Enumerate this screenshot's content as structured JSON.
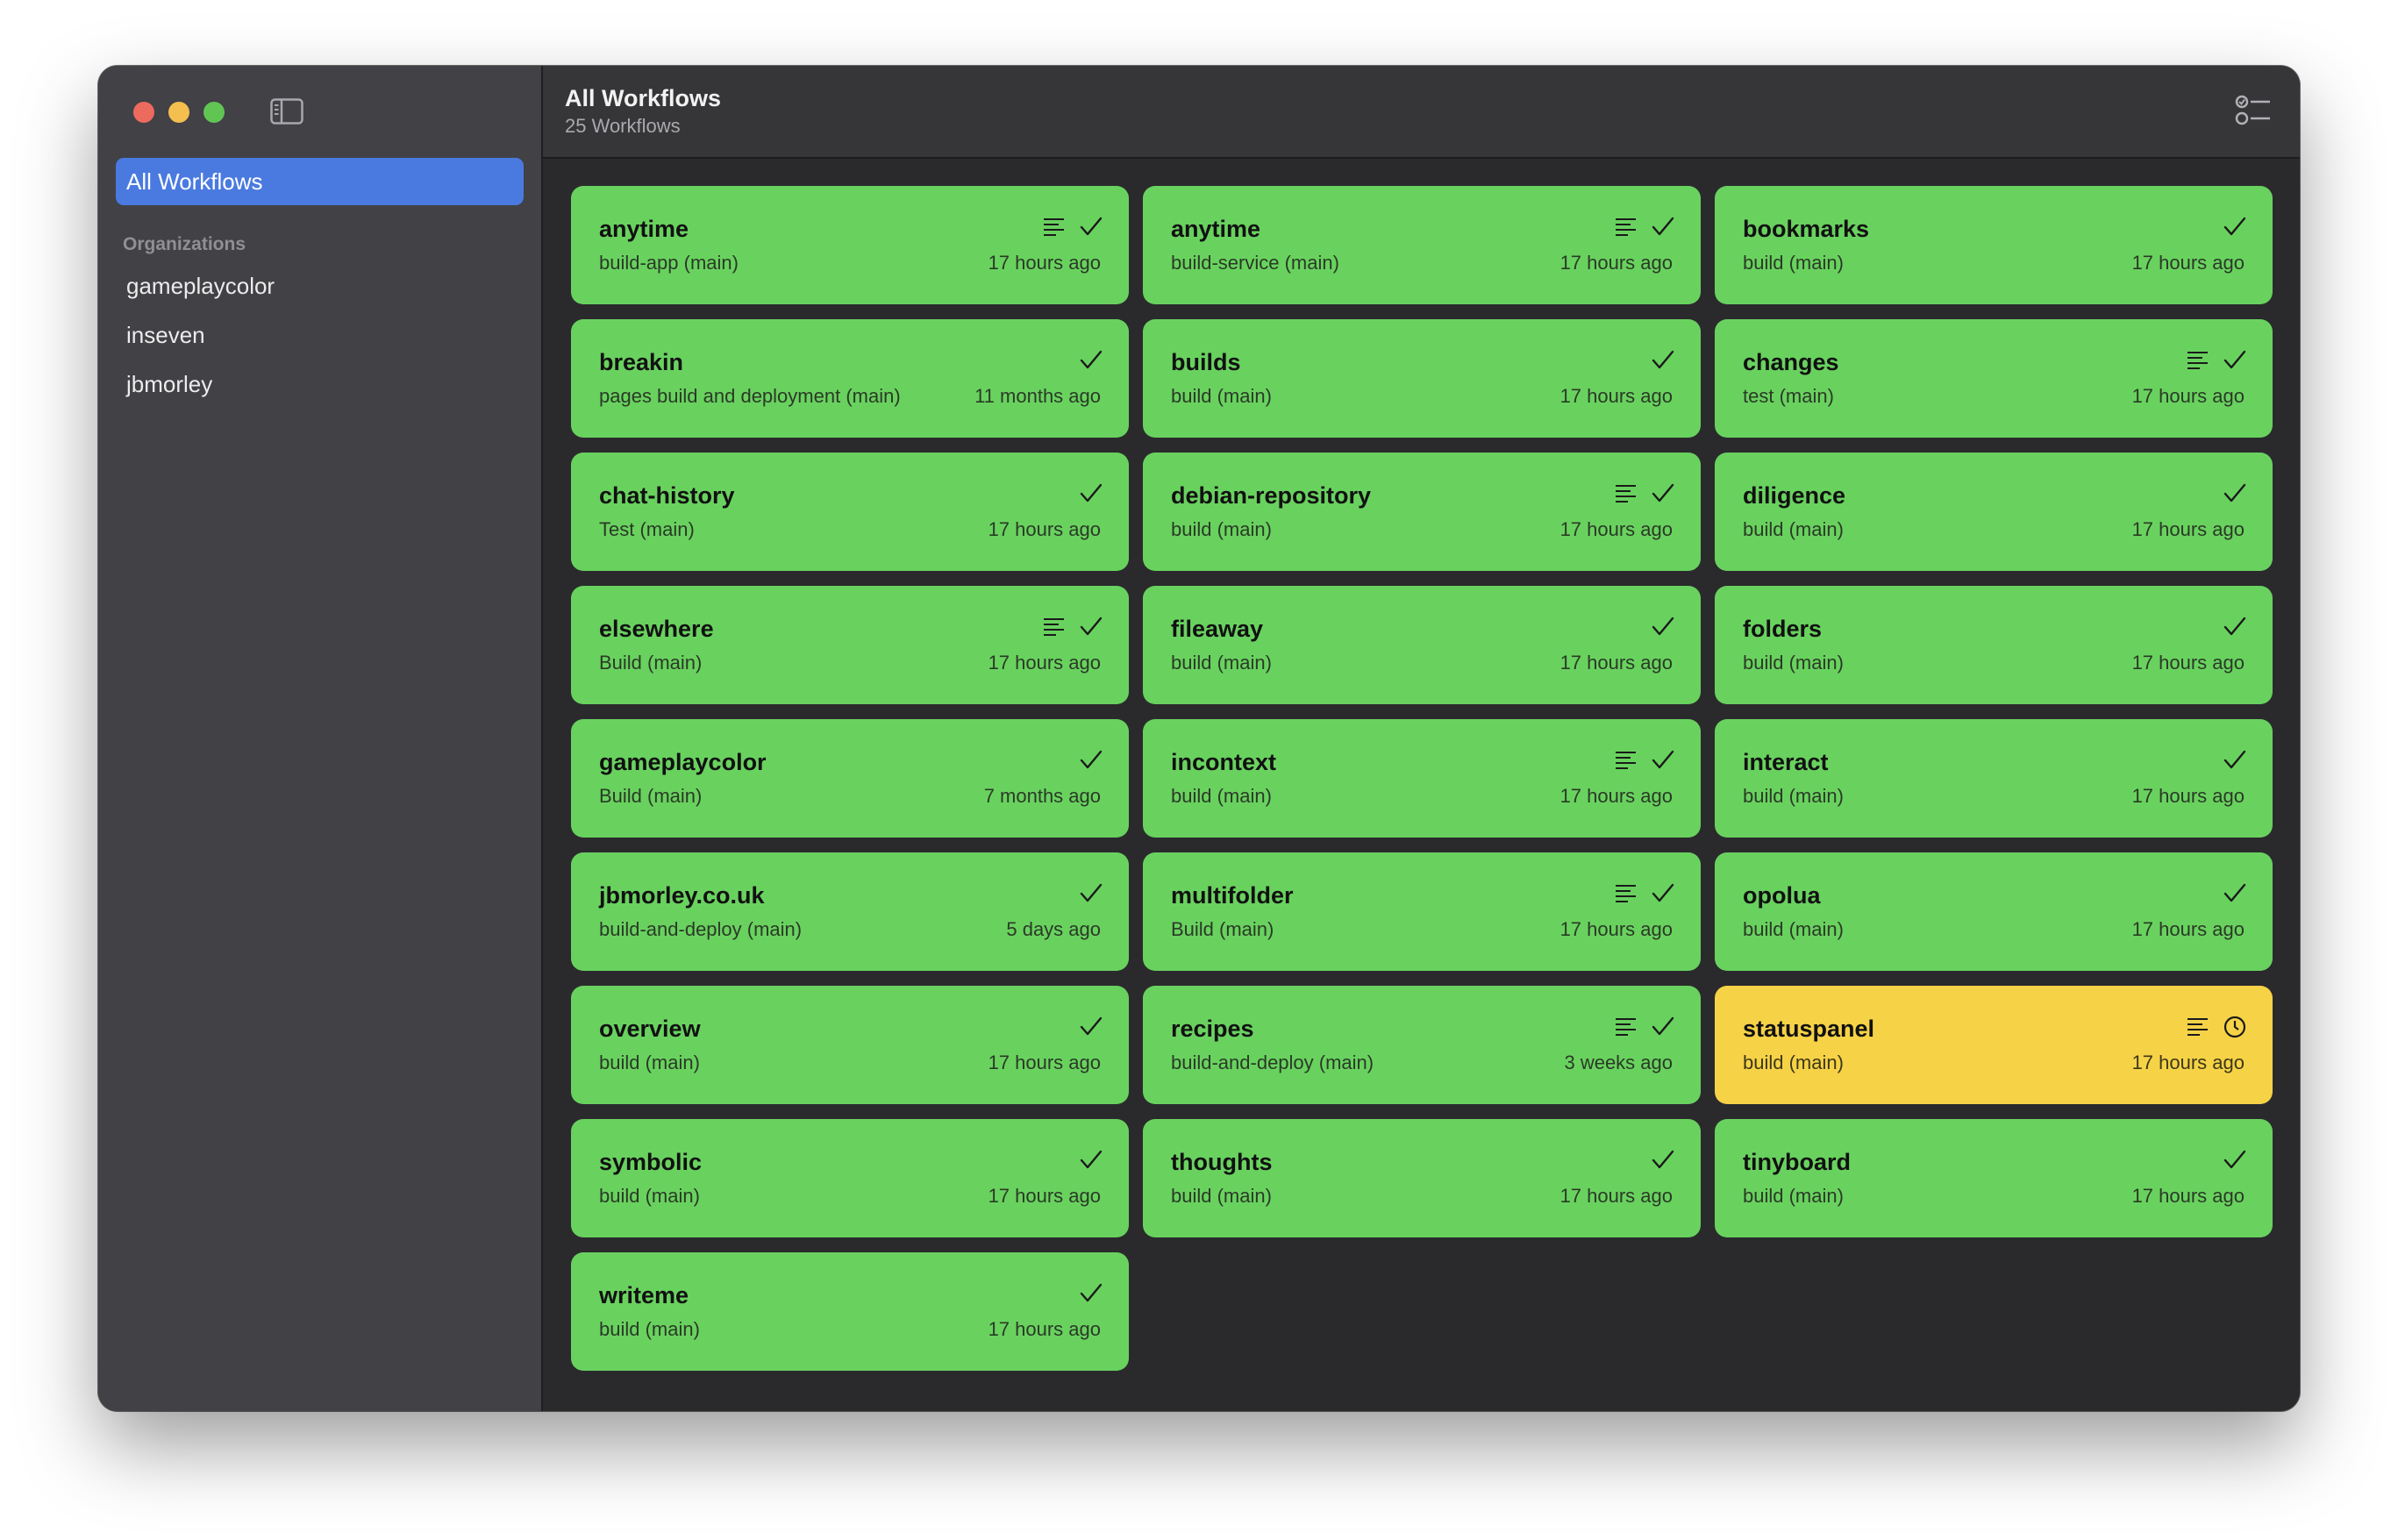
{
  "sidebar": {
    "selected_item": "All Workflows",
    "section_label": "Organizations",
    "organizations": [
      "gameplaycolor",
      "inseven",
      "jbmorley"
    ]
  },
  "header": {
    "title": "All Workflows",
    "subtitle": "25 Workflows"
  },
  "colors": {
    "success": "#69d25f",
    "in_progress": "#f6d247",
    "accent": "#4a7ae0"
  },
  "workflows": [
    {
      "name": "anytime",
      "workflow": "build-app (main)",
      "time": "17 hours ago",
      "status": "success",
      "has_log": true
    },
    {
      "name": "anytime",
      "workflow": "build-service (main)",
      "time": "17 hours ago",
      "status": "success",
      "has_log": true
    },
    {
      "name": "bookmarks",
      "workflow": "build (main)",
      "time": "17 hours ago",
      "status": "success",
      "has_log": false
    },
    {
      "name": "breakin",
      "workflow": "pages build and deployment (main)",
      "time": "11 months ago",
      "status": "success",
      "has_log": false
    },
    {
      "name": "builds",
      "workflow": "build (main)",
      "time": "17 hours ago",
      "status": "success",
      "has_log": false
    },
    {
      "name": "changes",
      "workflow": "test (main)",
      "time": "17 hours ago",
      "status": "success",
      "has_log": true
    },
    {
      "name": "chat-history",
      "workflow": "Test (main)",
      "time": "17 hours ago",
      "status": "success",
      "has_log": false
    },
    {
      "name": "debian-repository",
      "workflow": "build (main)",
      "time": "17 hours ago",
      "status": "success",
      "has_log": true
    },
    {
      "name": "diligence",
      "workflow": "build (main)",
      "time": "17 hours ago",
      "status": "success",
      "has_log": false
    },
    {
      "name": "elsewhere",
      "workflow": "Build (main)",
      "time": "17 hours ago",
      "status": "success",
      "has_log": true
    },
    {
      "name": "fileaway",
      "workflow": "build (main)",
      "time": "17 hours ago",
      "status": "success",
      "has_log": false
    },
    {
      "name": "folders",
      "workflow": "build (main)",
      "time": "17 hours ago",
      "status": "success",
      "has_log": false
    },
    {
      "name": "gameplaycolor",
      "workflow": "Build (main)",
      "time": "7 months ago",
      "status": "success",
      "has_log": false
    },
    {
      "name": "incontext",
      "workflow": "build (main)",
      "time": "17 hours ago",
      "status": "success",
      "has_log": true
    },
    {
      "name": "interact",
      "workflow": "build (main)",
      "time": "17 hours ago",
      "status": "success",
      "has_log": false
    },
    {
      "name": "jbmorley.co.uk",
      "workflow": "build-and-deploy (main)",
      "time": "5 days ago",
      "status": "success",
      "has_log": false
    },
    {
      "name": "multifolder",
      "workflow": "Build (main)",
      "time": "17 hours ago",
      "status": "success",
      "has_log": true
    },
    {
      "name": "opolua",
      "workflow": "build (main)",
      "time": "17 hours ago",
      "status": "success",
      "has_log": false
    },
    {
      "name": "overview",
      "workflow": "build (main)",
      "time": "17 hours ago",
      "status": "success",
      "has_log": false
    },
    {
      "name": "recipes",
      "workflow": "build-and-deploy (main)",
      "time": "3 weeks ago",
      "status": "success",
      "has_log": true
    },
    {
      "name": "statuspanel",
      "workflow": "build (main)",
      "time": "17 hours ago",
      "status": "in-progress",
      "has_log": true
    },
    {
      "name": "symbolic",
      "workflow": "build (main)",
      "time": "17 hours ago",
      "status": "success",
      "has_log": false
    },
    {
      "name": "thoughts",
      "workflow": "build (main)",
      "time": "17 hours ago",
      "status": "success",
      "has_log": false
    },
    {
      "name": "tinyboard",
      "workflow": "build (main)",
      "time": "17 hours ago",
      "status": "success",
      "has_log": false
    },
    {
      "name": "writeme",
      "workflow": "build (main)",
      "time": "17 hours ago",
      "status": "success",
      "has_log": false
    }
  ]
}
